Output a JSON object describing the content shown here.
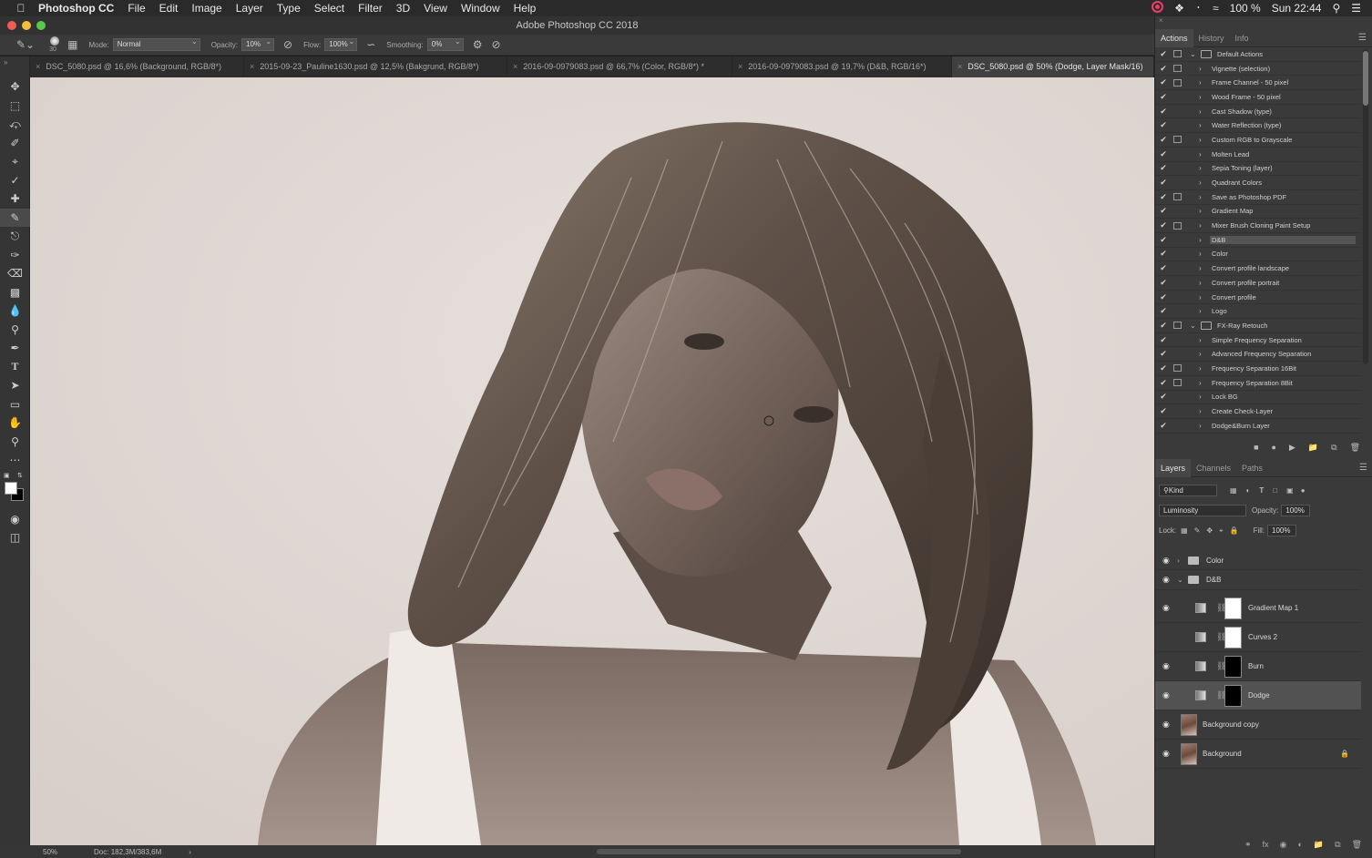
{
  "menubar": {
    "app": "Photoshop CC",
    "items": [
      "File",
      "Edit",
      "Image",
      "Layer",
      "Type",
      "Select",
      "Filter",
      "3D",
      "View",
      "Window",
      "Help"
    ],
    "battery": "100 %",
    "clock": "Sun 22:44"
  },
  "window_title": "Adobe Photoshop CC 2018",
  "options": {
    "brush_size": "30",
    "mode_label": "Mode:",
    "mode": "Normal",
    "opacity_label": "Opacity:",
    "opacity": "10%",
    "flow_label": "Flow:",
    "flow": "100%",
    "smoothing_label": "Smoothing:",
    "smoothing": "0%"
  },
  "doc_tabs": [
    {
      "title": "DSC_5080.psd @ 16,6% (Background, RGB/8*)"
    },
    {
      "title": "2015-09-23_Pauline1630.psd @ 12,5% (Bakgrund, RGB/8*)"
    },
    {
      "title": "2016-09-0979083.psd @ 66,7% (Color, RGB/8*) *"
    },
    {
      "title": "2016-09-0979083.psd @ 19,7% (D&B, RGB/16*)"
    },
    {
      "title": "DSC_5080.psd @ 50% (Dodge, Layer Mask/16)"
    }
  ],
  "status": {
    "zoom": "50%",
    "doc": "Doc: 182,3M/383,6M"
  },
  "actions_panel": {
    "tabs": [
      "Actions",
      "History",
      "Info"
    ],
    "items": [
      {
        "label": "Default Actions",
        "set": true,
        "dialog": true
      },
      {
        "label": "Vignette (selection)",
        "dialog": true
      },
      {
        "label": "Frame Channel - 50 pixel",
        "dialog": true
      },
      {
        "label": "Wood Frame - 50 pixel"
      },
      {
        "label": "Cast Shadow (type)"
      },
      {
        "label": "Water Reflection (type)"
      },
      {
        "label": "Custom RGB to Grayscale",
        "dialog": true
      },
      {
        "label": "Molten Lead"
      },
      {
        "label": "Sepia Toning (layer)"
      },
      {
        "label": "Quadrant Colors"
      },
      {
        "label": "Save as Photoshop PDF",
        "dialog": true
      },
      {
        "label": "Gradient Map"
      },
      {
        "label": "Mixer Brush Cloning Paint Setup",
        "dialog": true
      },
      {
        "label": "D&B",
        "selected": true
      },
      {
        "label": "Color"
      },
      {
        "label": "Convert profile landscape"
      },
      {
        "label": "Convert profile portrait"
      },
      {
        "label": "Convert profile"
      },
      {
        "label": "Logo"
      },
      {
        "label": "FX-Ray Retouch",
        "set": true,
        "dialog": true
      },
      {
        "label": "Simple Frequency Separation"
      },
      {
        "label": "Advanced Frequency Separation"
      },
      {
        "label": "Frequency Separation 16Bit",
        "dialog": true
      },
      {
        "label": "Frequency Separation 8Bit",
        "dialog": true
      },
      {
        "label": "Lock BG"
      },
      {
        "label": "Create Check-Layer"
      },
      {
        "label": "Dodge&Burn Layer"
      }
    ]
  },
  "layers_panel": {
    "tabs": [
      "Layers",
      "Channels",
      "Paths"
    ],
    "filter": "Kind",
    "blend_mode": "Luminosity",
    "opacity_label": "Opacity:",
    "opacity": "100%",
    "lock_label": "Lock:",
    "fill_label": "Fill:",
    "fill": "100%",
    "layers": [
      {
        "name": "Color",
        "kind": "group",
        "visible": true
      },
      {
        "name": "D&B",
        "kind": "group",
        "visible": true,
        "open": true
      },
      {
        "name": "Gradient Map 1",
        "kind": "adjustment",
        "mask": "white",
        "visible": true
      },
      {
        "name": "Curves 2",
        "kind": "adjustment",
        "mask": "white",
        "visible": false
      },
      {
        "name": "Burn",
        "kind": "adjustment",
        "mask": "black",
        "visible": true
      },
      {
        "name": "Dodge",
        "kind": "adjustment",
        "mask": "black",
        "visible": true,
        "selected": true
      },
      {
        "name": "Background copy",
        "kind": "pixel",
        "visible": true
      },
      {
        "name": "Background",
        "kind": "pixel",
        "visible": true,
        "locked": true
      }
    ]
  }
}
